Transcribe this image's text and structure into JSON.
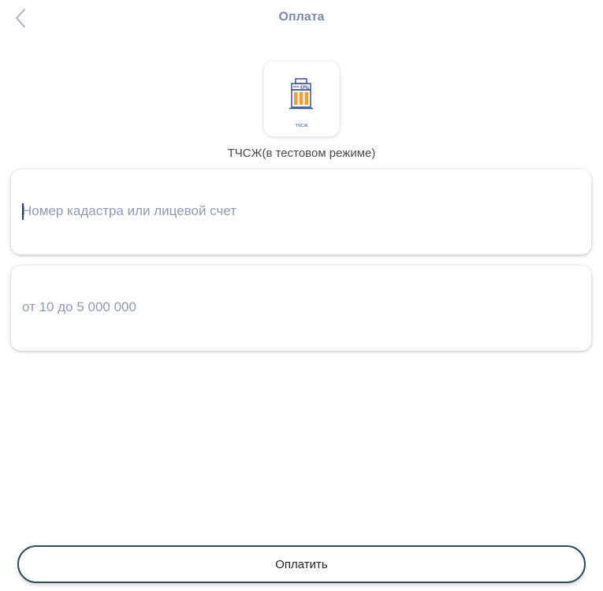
{
  "header": {
    "title": "Оплата",
    "back_icon": "chevron-left-icon"
  },
  "provider": {
    "logo_icon": "building-icon",
    "logo_badge": "ЕРЦ",
    "logo_caption": "ТЧСЖ",
    "name": "ТЧСЖ(в тестовом режиме)",
    "colors": {
      "building_outline": "#2b4a8b",
      "building_windows": "#f5a031",
      "caption": "#2b4a8b"
    }
  },
  "form": {
    "account": {
      "placeholder": "Номер кадастра или лицевой счет",
      "value": ""
    },
    "amount": {
      "placeholder": "от 10 до 5 000 000",
      "value": ""
    }
  },
  "actions": {
    "pay_label": "Оплатить"
  },
  "colors": {
    "title": "#7d8aa6",
    "placeholder": "#8f99b0",
    "button_border": "#34495a"
  }
}
